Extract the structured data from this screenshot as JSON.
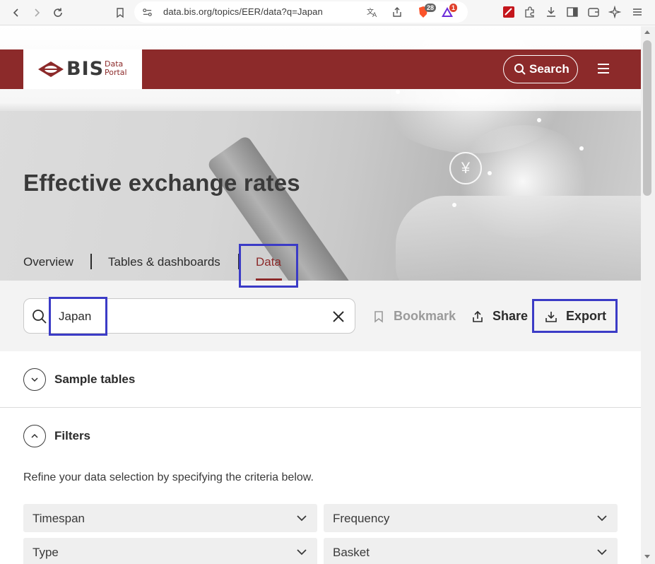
{
  "browser": {
    "url": "data.bis.org/topics/EER/data?q=Japan",
    "ext_badge_shield": "28",
    "ext_badge_alert": "1"
  },
  "header": {
    "logo_text": "BIS",
    "logo_sub_line1": "Data",
    "logo_sub_line2": "Portal",
    "search_label": "Search",
    "brand_color": "#8c2a2a"
  },
  "hero": {
    "title": "Effective exchange rates",
    "coin_symbol": "¥"
  },
  "tabs": [
    {
      "label": "Overview"
    },
    {
      "label": "Tables & dashboards"
    },
    {
      "label": "Data",
      "active": true
    }
  ],
  "toolbar": {
    "search_value": "Japan",
    "bookmark_label": "Bookmark",
    "share_label": "Share",
    "export_label": "Export"
  },
  "sections": {
    "sample_tables": "Sample tables",
    "filters": "Filters"
  },
  "filters": {
    "description": "Refine your data selection by specifying the criteria below.",
    "dropdowns": [
      {
        "label": "Timespan"
      },
      {
        "label": "Frequency"
      },
      {
        "label": "Type"
      },
      {
        "label": "Basket"
      }
    ]
  },
  "annotations": {
    "highlight_color": "#3b3bc6"
  }
}
